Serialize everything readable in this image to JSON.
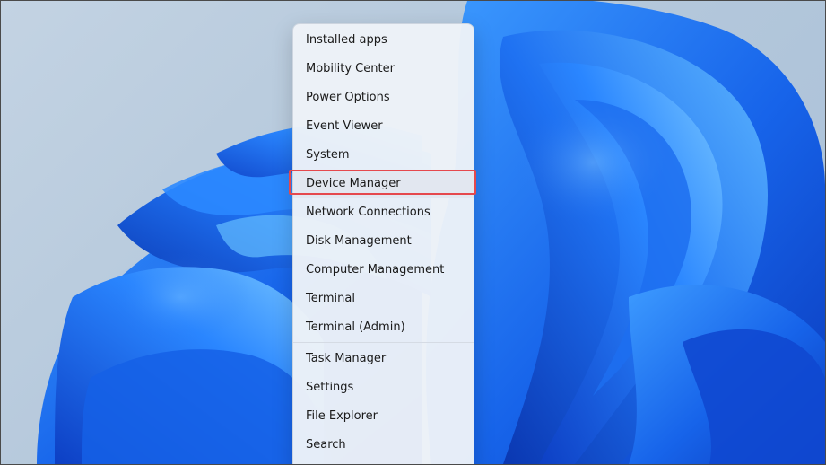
{
  "desktop": {
    "wallpaper": "windows-11-bloom",
    "colors": {
      "background": "#b9cbdc",
      "bloom_dark": "#0d3fc4",
      "bloom_mid": "#1f6ef0",
      "bloom_light": "#47a6ff",
      "highlight": "#e5484d"
    }
  },
  "menu": {
    "items": [
      {
        "label": "Installed apps"
      },
      {
        "label": "Mobility Center"
      },
      {
        "label": "Power Options"
      },
      {
        "label": "Event Viewer"
      },
      {
        "label": "System"
      },
      {
        "label": "Device Manager",
        "highlighted": true
      },
      {
        "label": "Network Connections"
      },
      {
        "label": "Disk Management"
      },
      {
        "label": "Computer Management"
      },
      {
        "label": "Terminal"
      },
      {
        "label": "Terminal (Admin)"
      },
      {
        "label": "Task Manager"
      },
      {
        "label": "Settings"
      },
      {
        "label": "File Explorer"
      },
      {
        "label": "Search"
      }
    ]
  }
}
